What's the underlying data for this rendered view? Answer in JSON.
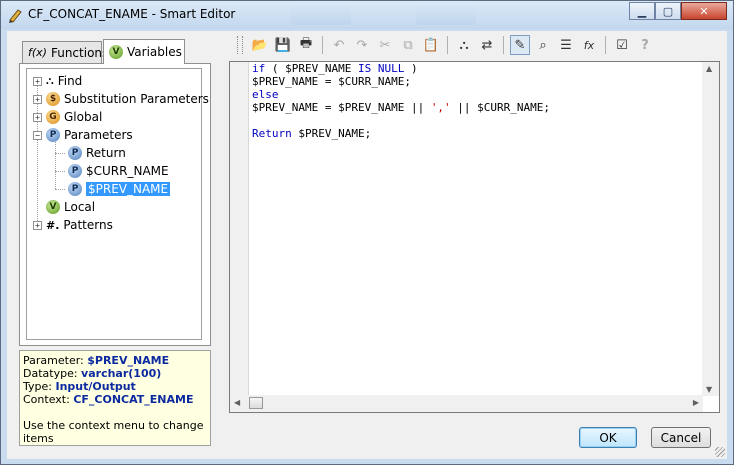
{
  "window": {
    "title": "CF_CONCAT_ENAME - Smart Editor"
  },
  "tabs": [
    {
      "label": "Functions",
      "icon": "function-icon"
    },
    {
      "label": "Variables",
      "icon": "variable-icon"
    }
  ],
  "tree": {
    "items": [
      {
        "label": "Find",
        "icon": "binoculars-icon",
        "expander": "+"
      },
      {
        "label": "Substitution Parameters",
        "icon": "substitution-parameter-icon",
        "icon_letter": "$",
        "expander": "+"
      },
      {
        "label": "Global",
        "icon": "global-variable-icon",
        "icon_letter": "G",
        "expander": "+"
      },
      {
        "label": "Parameters",
        "icon": "parameter-icon",
        "icon_letter": "P",
        "expander": "−"
      },
      {
        "label": "Return",
        "icon": "parameter-icon",
        "icon_letter": "P"
      },
      {
        "label": "$CURR_NAME",
        "icon": "parameter-icon",
        "icon_letter": "P"
      },
      {
        "label": "$PREV_NAME",
        "icon": "parameter-icon",
        "icon_letter": "P",
        "selected": true
      },
      {
        "label": "Local",
        "icon": "local-variable-icon",
        "icon_letter": "V"
      },
      {
        "label": "Patterns",
        "icon": "pattern-icon",
        "icon_letter": "#.",
        "expander": "+"
      }
    ]
  },
  "info": {
    "parameter_label": "Parameter:",
    "parameter_value": "$PREV_NAME",
    "datatype_label": "Datatype:",
    "datatype_value": "varchar(100)",
    "type_label": "Type:",
    "type_value": "Input/Output",
    "context_label": "Context:",
    "context_value": "CF_CONCAT_ENAME",
    "hint": "Use the context menu to change items"
  },
  "code": {
    "l1_kw1": "if",
    "l1_a": " ( $PREV_NAME ",
    "l1_kw2": "IS NULL",
    "l1_b": " )",
    "l2": "$PREV_NAME = $CURR_NAME;",
    "l3_kw": "else",
    "l4_a": "$PREV_NAME = $PREV_NAME || ",
    "l4_str": "','",
    "l4_b": " || $CURR_NAME;",
    "l5": "",
    "l6_kw": "Return",
    "l6_b": " $PREV_NAME;"
  },
  "buttons": {
    "ok": "OK",
    "cancel": "Cancel"
  },
  "icons": {
    "toolbar": [
      "open-folder-icon",
      "save-icon",
      "print-icon",
      "undo-icon",
      "redo-icon",
      "cut-icon",
      "copy-icon",
      "paste-icon",
      "find-icon",
      "find-replace-icon",
      "show-library-icon",
      "smart-lookup-icon",
      "list-icon",
      "function-icon",
      "validate-icon",
      "help-icon"
    ]
  }
}
